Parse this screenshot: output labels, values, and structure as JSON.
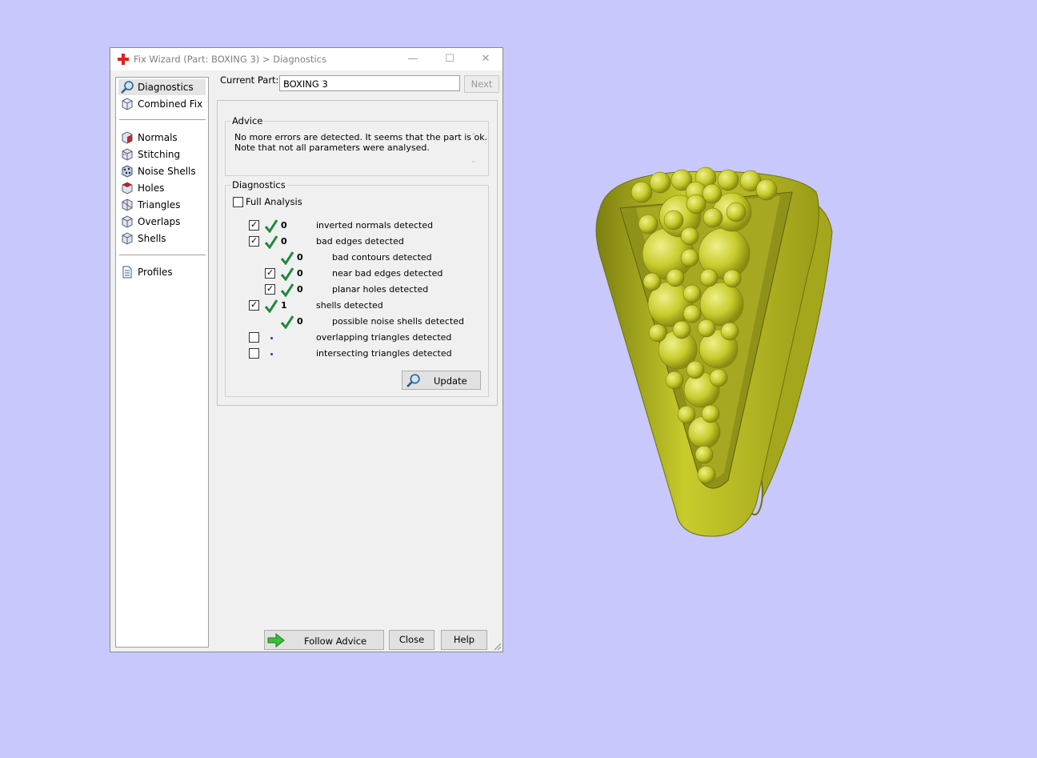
{
  "window": {
    "title": "Fix Wizard (Part: BOXING 3) > Diagnostics",
    "min_glyph": "—",
    "max_glyph": "☐",
    "close_glyph": "✕"
  },
  "nav": {
    "items": [
      {
        "label": "Diagnostics",
        "icon": "magnifier-icon"
      },
      {
        "label": "Combined Fix",
        "icon": "cube-icon"
      },
      {
        "label": "Normals",
        "icon": "normals-cube-icon"
      },
      {
        "label": "Stitching",
        "icon": "stitching-cube-icon"
      },
      {
        "label": "Noise Shells",
        "icon": "noise-shells-icon"
      },
      {
        "label": "Holes",
        "icon": "holes-cube-icon"
      },
      {
        "label": "Triangles",
        "icon": "triangles-cube-icon"
      },
      {
        "label": "Overlaps",
        "icon": "overlaps-cube-icon"
      },
      {
        "label": "Shells",
        "icon": "shells-cube-icon"
      },
      {
        "label": "Profiles",
        "icon": "document-icon"
      }
    ]
  },
  "current_part": {
    "label": "Current Part:",
    "value": "BOXING 3",
    "next_label": "Next"
  },
  "advice": {
    "title": "Advice",
    "line1": "No more errors are detected. It seems that the part is ok.",
    "line2": "Note that not all parameters were analysed."
  },
  "diagnostics": {
    "title": "Diagnostics",
    "full_analysis_label": "Full Analysis",
    "full_analysis_checked": false,
    "rows": [
      {
        "checked": true,
        "count": "0",
        "label": "inverted normals detected"
      },
      {
        "checked": true,
        "count": "0",
        "label": "bad edges detected"
      },
      {
        "checked": null,
        "count": "0",
        "label": "bad contours detected"
      },
      {
        "checked": true,
        "count": "0",
        "label": "near bad edges detected"
      },
      {
        "checked": true,
        "count": "0",
        "label": "planar holes detected"
      },
      {
        "checked": true,
        "count": "1",
        "label": "shells detected"
      },
      {
        "checked": null,
        "count": "0",
        "label": "possible noise shells detected"
      },
      {
        "checked": false,
        "count": "",
        "label": "overlapping triangles detected"
      },
      {
        "checked": false,
        "count": "",
        "label": "intersecting triangles detected"
      }
    ],
    "update_label": "Update"
  },
  "footer": {
    "follow_label": "Follow Advice",
    "close_label": "Close",
    "help_label": "Help"
  },
  "colors": {
    "background": "#c8c8fc",
    "model": "#c8cc2c",
    "tick": "#1e8a3a"
  }
}
